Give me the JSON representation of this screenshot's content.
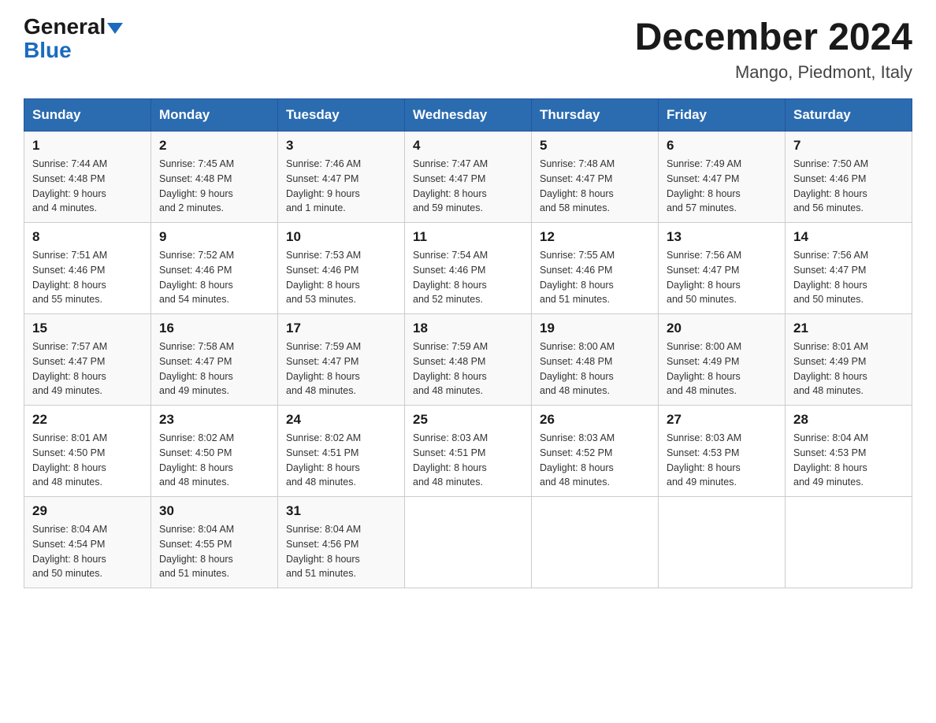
{
  "header": {
    "logo_line1": "General",
    "logo_line2": "Blue",
    "title": "December 2024",
    "subtitle": "Mango, Piedmont, Italy"
  },
  "columns": [
    "Sunday",
    "Monday",
    "Tuesday",
    "Wednesday",
    "Thursday",
    "Friday",
    "Saturday"
  ],
  "weeks": [
    [
      {
        "day": "1",
        "info": "Sunrise: 7:44 AM\nSunset: 4:48 PM\nDaylight: 9 hours\nand 4 minutes."
      },
      {
        "day": "2",
        "info": "Sunrise: 7:45 AM\nSunset: 4:48 PM\nDaylight: 9 hours\nand 2 minutes."
      },
      {
        "day": "3",
        "info": "Sunrise: 7:46 AM\nSunset: 4:47 PM\nDaylight: 9 hours\nand 1 minute."
      },
      {
        "day": "4",
        "info": "Sunrise: 7:47 AM\nSunset: 4:47 PM\nDaylight: 8 hours\nand 59 minutes."
      },
      {
        "day": "5",
        "info": "Sunrise: 7:48 AM\nSunset: 4:47 PM\nDaylight: 8 hours\nand 58 minutes."
      },
      {
        "day": "6",
        "info": "Sunrise: 7:49 AM\nSunset: 4:47 PM\nDaylight: 8 hours\nand 57 minutes."
      },
      {
        "day": "7",
        "info": "Sunrise: 7:50 AM\nSunset: 4:46 PM\nDaylight: 8 hours\nand 56 minutes."
      }
    ],
    [
      {
        "day": "8",
        "info": "Sunrise: 7:51 AM\nSunset: 4:46 PM\nDaylight: 8 hours\nand 55 minutes."
      },
      {
        "day": "9",
        "info": "Sunrise: 7:52 AM\nSunset: 4:46 PM\nDaylight: 8 hours\nand 54 minutes."
      },
      {
        "day": "10",
        "info": "Sunrise: 7:53 AM\nSunset: 4:46 PM\nDaylight: 8 hours\nand 53 minutes."
      },
      {
        "day": "11",
        "info": "Sunrise: 7:54 AM\nSunset: 4:46 PM\nDaylight: 8 hours\nand 52 minutes."
      },
      {
        "day": "12",
        "info": "Sunrise: 7:55 AM\nSunset: 4:46 PM\nDaylight: 8 hours\nand 51 minutes."
      },
      {
        "day": "13",
        "info": "Sunrise: 7:56 AM\nSunset: 4:47 PM\nDaylight: 8 hours\nand 50 minutes."
      },
      {
        "day": "14",
        "info": "Sunrise: 7:56 AM\nSunset: 4:47 PM\nDaylight: 8 hours\nand 50 minutes."
      }
    ],
    [
      {
        "day": "15",
        "info": "Sunrise: 7:57 AM\nSunset: 4:47 PM\nDaylight: 8 hours\nand 49 minutes."
      },
      {
        "day": "16",
        "info": "Sunrise: 7:58 AM\nSunset: 4:47 PM\nDaylight: 8 hours\nand 49 minutes."
      },
      {
        "day": "17",
        "info": "Sunrise: 7:59 AM\nSunset: 4:47 PM\nDaylight: 8 hours\nand 48 minutes."
      },
      {
        "day": "18",
        "info": "Sunrise: 7:59 AM\nSunset: 4:48 PM\nDaylight: 8 hours\nand 48 minutes."
      },
      {
        "day": "19",
        "info": "Sunrise: 8:00 AM\nSunset: 4:48 PM\nDaylight: 8 hours\nand 48 minutes."
      },
      {
        "day": "20",
        "info": "Sunrise: 8:00 AM\nSunset: 4:49 PM\nDaylight: 8 hours\nand 48 minutes."
      },
      {
        "day": "21",
        "info": "Sunrise: 8:01 AM\nSunset: 4:49 PM\nDaylight: 8 hours\nand 48 minutes."
      }
    ],
    [
      {
        "day": "22",
        "info": "Sunrise: 8:01 AM\nSunset: 4:50 PM\nDaylight: 8 hours\nand 48 minutes."
      },
      {
        "day": "23",
        "info": "Sunrise: 8:02 AM\nSunset: 4:50 PM\nDaylight: 8 hours\nand 48 minutes."
      },
      {
        "day": "24",
        "info": "Sunrise: 8:02 AM\nSunset: 4:51 PM\nDaylight: 8 hours\nand 48 minutes."
      },
      {
        "day": "25",
        "info": "Sunrise: 8:03 AM\nSunset: 4:51 PM\nDaylight: 8 hours\nand 48 minutes."
      },
      {
        "day": "26",
        "info": "Sunrise: 8:03 AM\nSunset: 4:52 PM\nDaylight: 8 hours\nand 48 minutes."
      },
      {
        "day": "27",
        "info": "Sunrise: 8:03 AM\nSunset: 4:53 PM\nDaylight: 8 hours\nand 49 minutes."
      },
      {
        "day": "28",
        "info": "Sunrise: 8:04 AM\nSunset: 4:53 PM\nDaylight: 8 hours\nand 49 minutes."
      }
    ],
    [
      {
        "day": "29",
        "info": "Sunrise: 8:04 AM\nSunset: 4:54 PM\nDaylight: 8 hours\nand 50 minutes."
      },
      {
        "day": "30",
        "info": "Sunrise: 8:04 AM\nSunset: 4:55 PM\nDaylight: 8 hours\nand 51 minutes."
      },
      {
        "day": "31",
        "info": "Sunrise: 8:04 AM\nSunset: 4:56 PM\nDaylight: 8 hours\nand 51 minutes."
      },
      {
        "day": "",
        "info": ""
      },
      {
        "day": "",
        "info": ""
      },
      {
        "day": "",
        "info": ""
      },
      {
        "day": "",
        "info": ""
      }
    ]
  ]
}
